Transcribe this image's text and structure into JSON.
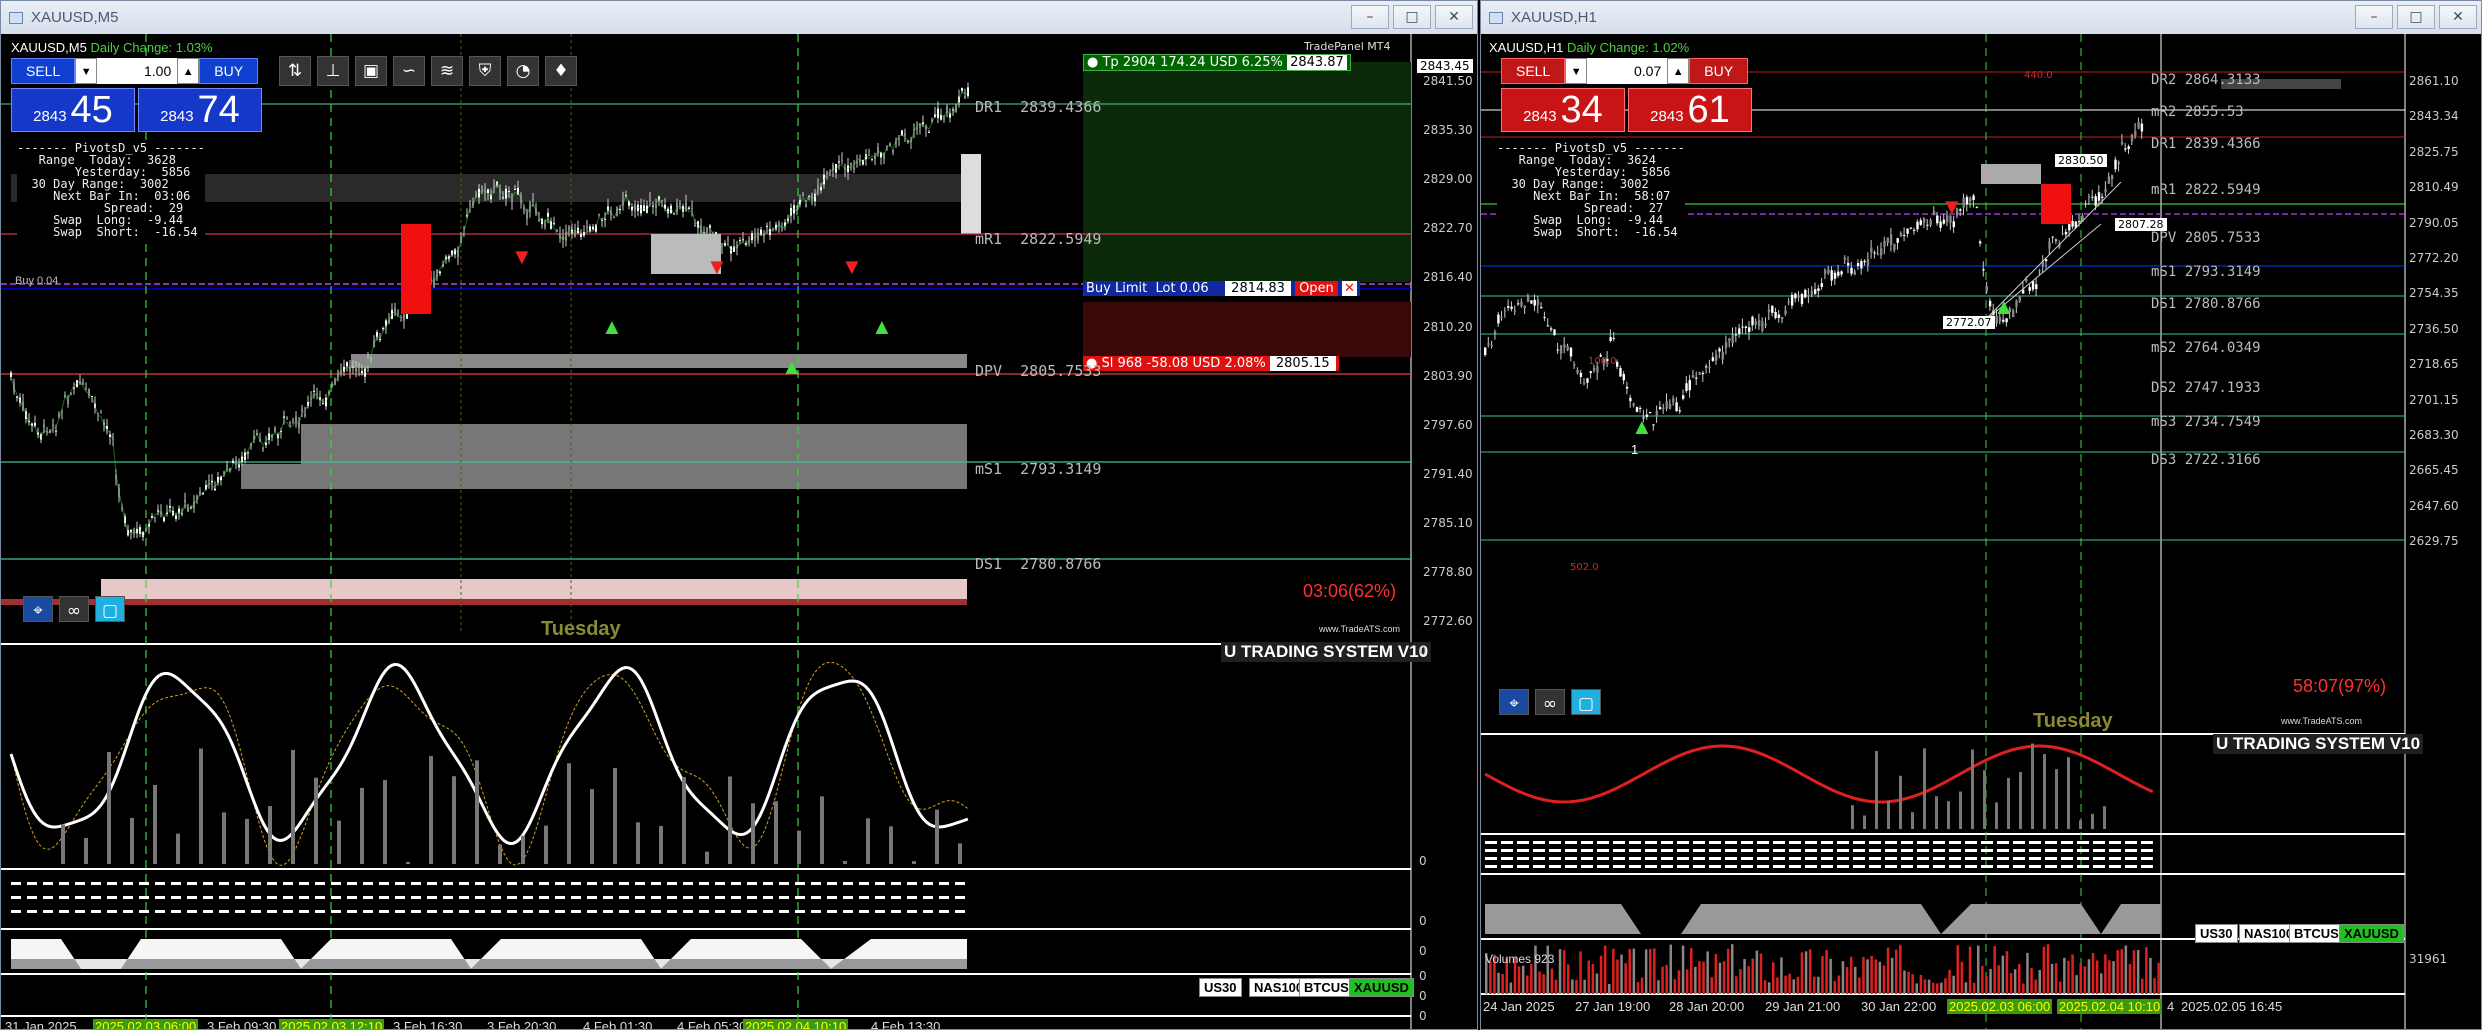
{
  "left": {
    "title": "XAUUSD,M5",
    "symline": "XAUUSD,M5",
    "daily_change": "Daily Change: 1.03%",
    "sell": "SELL",
    "buy": "BUY",
    "lot": "1.00",
    "bid_small": "2843",
    "bid_big": "45",
    "ask_small": "2843",
    "ask_big": "74",
    "tradepanel": "TradePanel MT4",
    "tp": {
      "label": "Tp",
      "pts": "2904",
      "usd": "174.24 USD",
      "pct": "6.25%",
      "price": "2843.87"
    },
    "buylimit": {
      "label": "Buy Limit",
      "lot": "Lot 0.06",
      "price": "2814.83",
      "open": "Open"
    },
    "sl": {
      "label": "Sl",
      "pts": "968",
      "usd": "-58.08 USD",
      "pct": "2.08%",
      "price": "2805.15"
    },
    "pivot": "------- PivotsD_v5 -------\n   Range  Today:  3628\n        Yesterday:  5856\n  30 Day Range:  3002\n     Next Bar In:  03:06\n            Spread:  29\n     Swap  Long:  -9.44\n     Swap  Short:  -16.54",
    "levels": [
      {
        "n": "DR1",
        "v": "2839.4366"
      },
      {
        "n": "mR1",
        "v": "2822.5949"
      },
      {
        "n": "DPV",
        "v": "2805.7533"
      },
      {
        "n": "mS1",
        "v": "2793.3149"
      },
      {
        "n": "DS1",
        "v": "2780.8766"
      }
    ],
    "axis": [
      "2841.50",
      "2835.30",
      "2829.00",
      "2822.70",
      "2816.40",
      "2810.20",
      "2803.90",
      "2797.60",
      "2791.40",
      "2785.10",
      "2778.80",
      "2772.60"
    ],
    "price_tag": "2843.45",
    "countdown": "03:06(62%)",
    "day": "Tuesday",
    "watermark": "www.TradeATS.com",
    "system": "U TRADING SYSTEM V10",
    "symbols": [
      "US30",
      "NAS100",
      "BTCUSD",
      "XAUUSD"
    ],
    "zeros": [
      "0",
      "0",
      "0",
      "0",
      "0",
      "0",
      "0",
      "0"
    ],
    "dates": [
      "31 Jan 2025",
      "2025.02.03 06:00",
      "3 Feb 09:30",
      "2025.02.03 12:10",
      "3 Feb 16:30",
      "3 Feb 20:30",
      "4 Feb 01:30",
      "4 Feb 05:30",
      "2025.02.04 10:10",
      "4 Feb 13:30"
    ],
    "chart_label_buy": "Buy 0.04"
  },
  "right": {
    "title": "XAUUSD,H1",
    "symline": "XAUUSD,H1",
    "daily_change": "Daily Change: 1.02%",
    "sell": "SELL",
    "buy": "BUY",
    "lot": "0.07",
    "bid_small": "2843",
    "bid_big": "34",
    "ask_small": "2843",
    "ask_big": "61",
    "pivot": "------- PivotsD_v5 -------\n   Range  Today:  3624\n        Yesterday:  5856\n  30 Day Range:  3002\n     Next Bar In:  58:07\n            Spread:  27\n     Swap  Long:  -9.44\n     Swap  Short:  -16.54",
    "levels": [
      {
        "n": "DR2",
        "v": "2864.3133"
      },
      {
        "n": "mR2",
        "v": "2855.53"
      },
      {
        "n": "DR1",
        "v": "2839.4366"
      },
      {
        "n": "mR1",
        "v": "2822.5949"
      },
      {
        "n": "DPV",
        "v": "2805.7533"
      },
      {
        "n": "mS1",
        "v": "2793.3149"
      },
      {
        "n": "DS1",
        "v": "2780.8766"
      },
      {
        "n": "mS2",
        "v": "2764.0349"
      },
      {
        "n": "DS2",
        "v": "2747.1933"
      },
      {
        "n": "mS3",
        "v": "2734.7549"
      },
      {
        "n": "DS3",
        "v": "2722.3166"
      }
    ],
    "axis": [
      "2861.10",
      "2843.34",
      "2825.75",
      "2810.49",
      "2790.05",
      "2772.20",
      "2754.35",
      "2736.50",
      "2718.65",
      "2701.15",
      "2683.30",
      "2665.45",
      "2647.60",
      "2629.75"
    ],
    "labels": [
      "2830.50",
      "2807.28",
      "2772.07",
      "440.0",
      "100.0",
      "502.0"
    ],
    "countdown": "58:07(97%)",
    "day": "Tuesday",
    "watermark": "www.TradeATS.com",
    "system": "U TRADING SYSTEM V10",
    "symbols": [
      "US30",
      "NAS100",
      "BTCUSD",
      "XAUUSD"
    ],
    "volumes": "Volumes 923",
    "vol_axis": "31961",
    "dates": [
      "24 Jan 2025",
      "27 Jan 19:00",
      "28 Jan 20:00",
      "29 Jan 21:00",
      "30 Jan 22:00",
      "2025.02.03 06:00",
      "2025.02.04 10:10",
      "4",
      "2025.02.05 16:45"
    ],
    "one": "1"
  }
}
